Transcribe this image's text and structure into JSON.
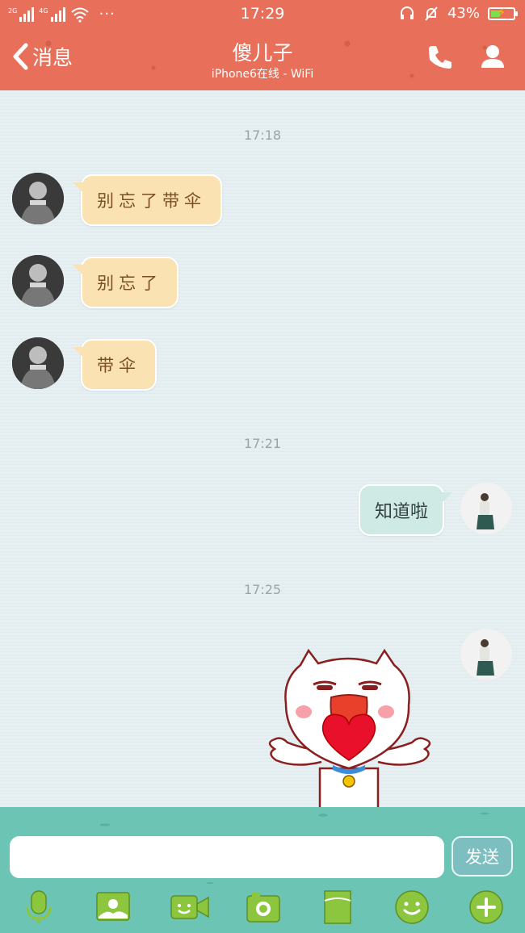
{
  "status_bar": {
    "time": "17:29",
    "battery_percent": "43%",
    "battery_level": 0.43,
    "network_tags": [
      "2G",
      "4G"
    ],
    "icons": [
      "signal-icon",
      "wifi-icon",
      "more-dots-icon",
      "headset-icon",
      "mute-bell-icon",
      "battery-icon"
    ]
  },
  "header": {
    "back_label": "消息",
    "title": "傻儿子",
    "subtitle": "iPhone6在线 - WiFi",
    "icons": [
      "back-chevron-icon",
      "phone-icon",
      "profile-icon"
    ]
  },
  "chat": {
    "timestamps": [
      "17:18",
      "17:21",
      "17:25"
    ],
    "messages": [
      {
        "from": "other",
        "text": "别忘了带伞"
      },
      {
        "from": "other",
        "text": "别忘了"
      },
      {
        "from": "other",
        "text": "带伞"
      },
      {
        "from": "me",
        "text": "知道啦"
      },
      {
        "from": "me",
        "type": "sticker",
        "sticker": "cat-heart-sticker"
      }
    ]
  },
  "input_bar": {
    "placeholder": "",
    "value": "",
    "send_label": "发送",
    "toolbar": [
      "microphone-icon",
      "image-icon",
      "video-icon",
      "camera-icon",
      "file-icon",
      "emoji-icon",
      "plus-icon"
    ]
  },
  "colors": {
    "header_bg": "#e8705a",
    "incoming_bubble": "#fbe2b3",
    "outgoing_bubble": "#cfe9e4",
    "input_bar_bg": "#6cc4b4",
    "icon_green": "#8cc63f"
  }
}
